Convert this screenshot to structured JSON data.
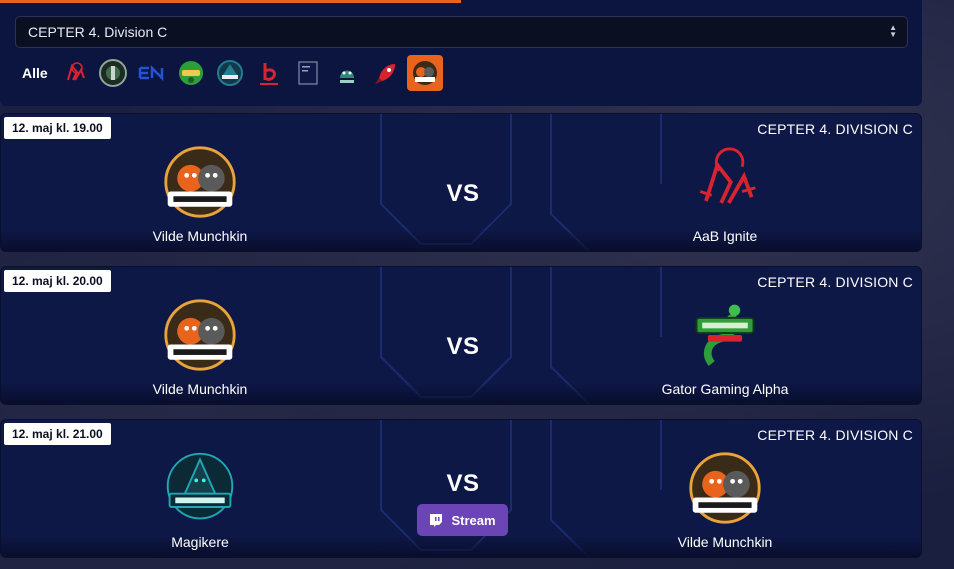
{
  "filter": {
    "selected": "CEPTER 4. Division C",
    "all_label": "Alle",
    "team_icons": [
      {
        "name": "aab-ignite-icon",
        "color": "#d9232f"
      },
      {
        "name": "green-crest-icon",
        "color": "#3f6b4a"
      },
      {
        "name": "en-logo-icon",
        "color": "#2452d6"
      },
      {
        "name": "gator-gaming-icon",
        "color": "#2e9e3a"
      },
      {
        "name": "magikere-icon",
        "color": "#1f7f8f"
      },
      {
        "name": "red-b-icon",
        "color": "#d9232f"
      },
      {
        "name": "document-logo-icon",
        "color": "#9aa0b8"
      },
      {
        "name": "dragon-icon",
        "color": "#2c8a7a"
      },
      {
        "name": "rocket-icon",
        "color": "#d9232f"
      },
      {
        "name": "vilde-katte-icon",
        "color": "#e8631c"
      }
    ],
    "active_color": "#e8631c"
  },
  "matches": [
    {
      "date": "12. maj kl. 19.00",
      "division": "CEPTER 4. DIVISION C",
      "home": "Vilde Munchkin",
      "away": "AaB Ignite",
      "vs": "VS",
      "home_logo": "vilde-katte-logo",
      "away_logo": "aab-ignite-logo"
    },
    {
      "date": "12. maj kl. 20.00",
      "division": "CEPTER 4. DIVISION C",
      "home": "Vilde Munchkin",
      "away": "Gator Gaming Alpha",
      "vs": "VS",
      "home_logo": "vilde-katte-logo",
      "away_logo": "gator-gaming-logo"
    },
    {
      "date": "12. maj kl. 21.00",
      "division": "CEPTER 4. DIVISION C",
      "home": "Magikere",
      "away": "Vilde Munchkin",
      "vs": "VS",
      "stream_label": "Stream",
      "home_logo": "magikere-logo",
      "away_logo": "vilde-katte-logo"
    }
  ],
  "colors": {
    "accent": "#e8631c",
    "card_bg": "#0e1847",
    "stream": "#6b45b5"
  }
}
